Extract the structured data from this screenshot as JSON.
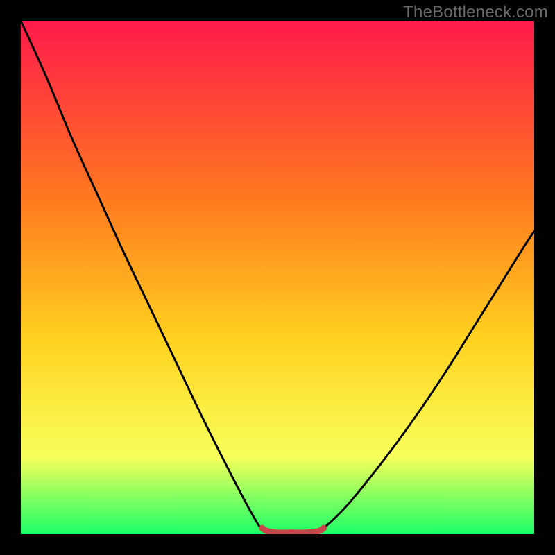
{
  "watermark": "TheBottleneck.com",
  "colors": {
    "frame": "#000000",
    "watermark_text": "#6a6a6a",
    "gradient_top": "#ff1a4b",
    "gradient_mid1": "#ff7a1f",
    "gradient_mid2": "#ffd21f",
    "gradient_mid3": "#f7ff5a",
    "gradient_bottom": "#1aff66",
    "curve_stroke": "#000000",
    "highlight_stroke": "#c9474a"
  },
  "chart_data": {
    "type": "line",
    "title": "",
    "xlabel": "",
    "ylabel": "",
    "x_range": [
      0,
      1
    ],
    "y_range": [
      0,
      100
    ],
    "series": [
      {
        "name": "left-curve",
        "x": [
          0.0,
          0.05,
          0.1,
          0.15,
          0.2,
          0.25,
          0.3,
          0.35,
          0.4,
          0.45,
          0.475
        ],
        "y": [
          100.0,
          89.0,
          77.0,
          66.0,
          55.0,
          44.5,
          34.0,
          23.5,
          13.5,
          4.0,
          0.5
        ]
      },
      {
        "name": "flat-min",
        "x": [
          0.475,
          0.5,
          0.53,
          0.555,
          0.58
        ],
        "y": [
          0.5,
          0.3,
          0.3,
          0.3,
          0.5
        ]
      },
      {
        "name": "right-curve",
        "x": [
          0.58,
          0.63,
          0.68,
          0.73,
          0.78,
          0.83,
          0.88,
          0.93,
          0.98,
          1.0
        ],
        "y": [
          0.5,
          5.0,
          11.0,
          17.5,
          24.5,
          32.0,
          40.0,
          48.0,
          56.0,
          59.0
        ]
      }
    ],
    "highlight_segment": {
      "name": "minimum-highlight",
      "x": [
        0.47,
        0.48,
        0.5,
        0.53,
        0.555,
        0.58,
        0.59
      ],
      "y": [
        1.2,
        0.6,
        0.3,
        0.3,
        0.3,
        0.6,
        1.2
      ]
    }
  }
}
